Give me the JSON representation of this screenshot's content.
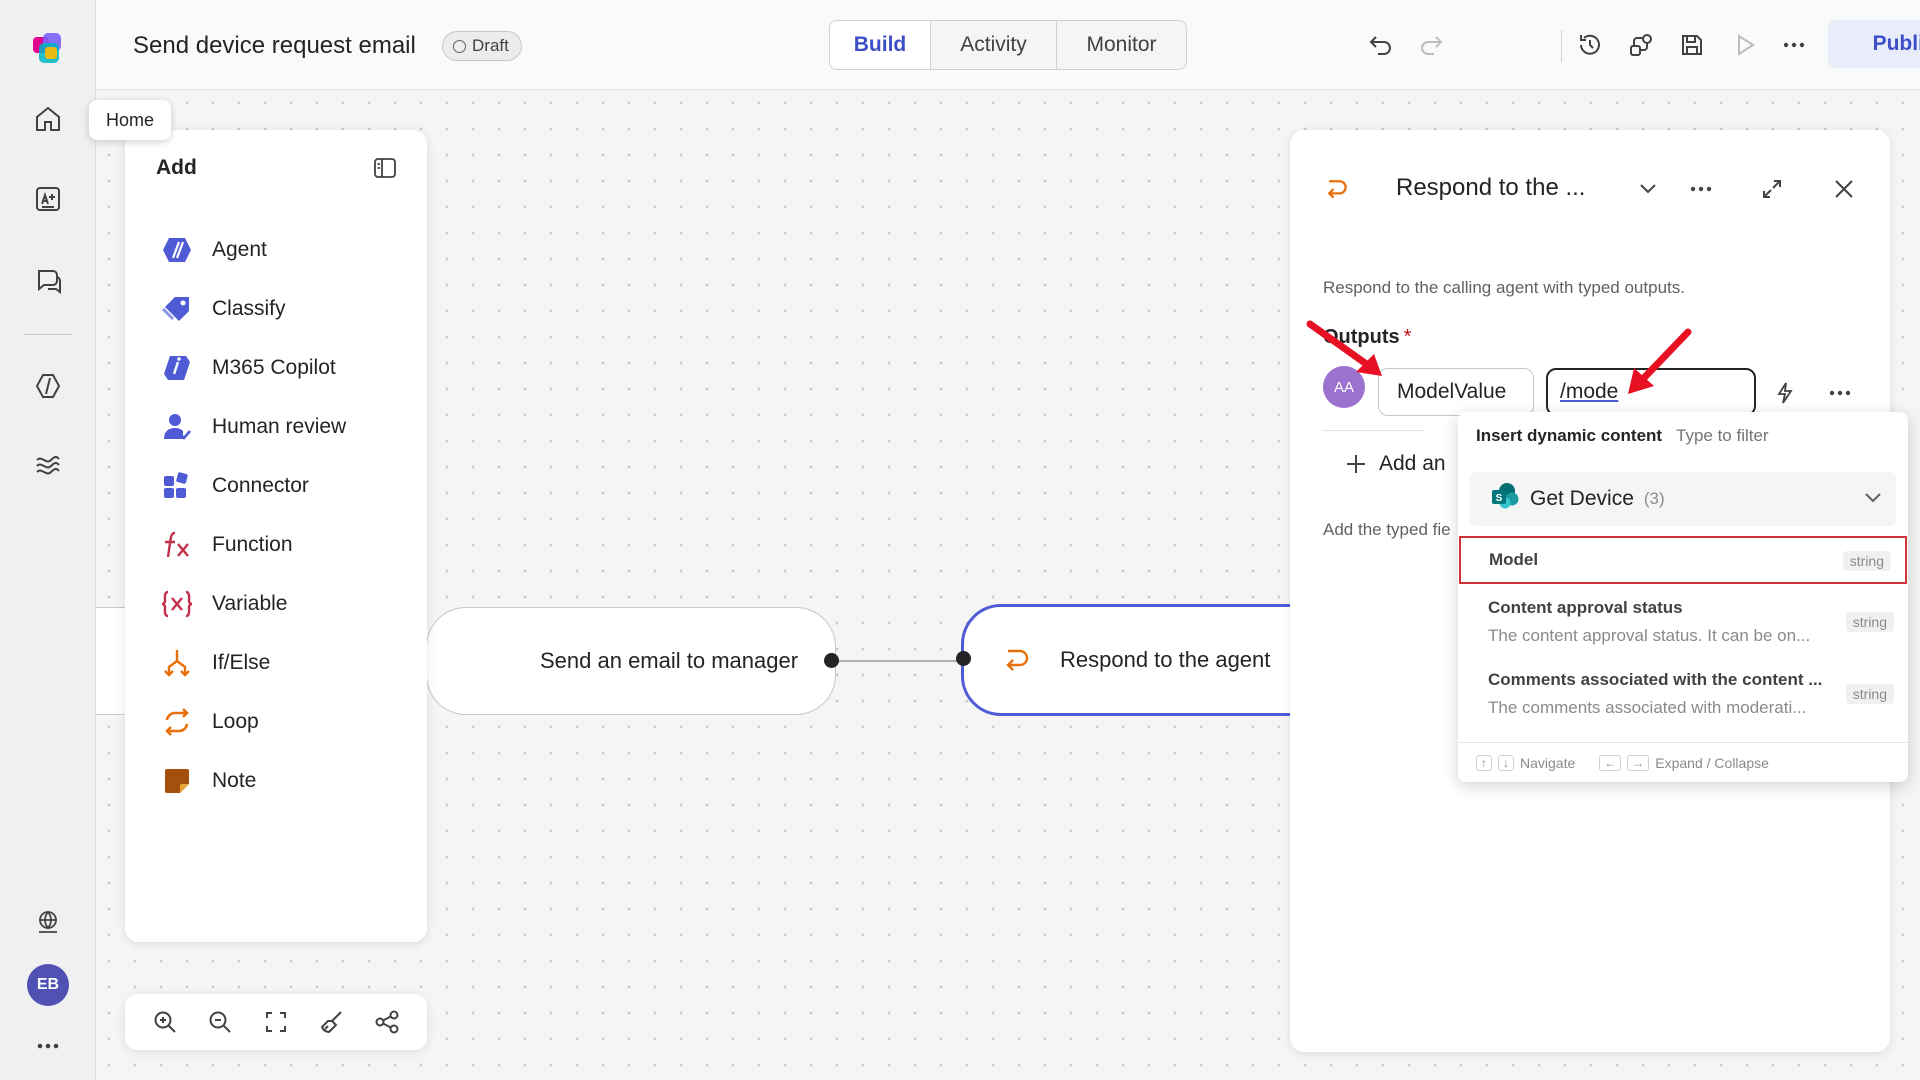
{
  "header": {
    "title": "Send device request email",
    "status_badge": "Draft",
    "tabs": [
      {
        "label": "Build",
        "active": true
      },
      {
        "label": "Activity",
        "active": false
      },
      {
        "label": "Monitor",
        "active": false
      }
    ],
    "toolbar_icons": [
      "undo-icon",
      "redo-icon",
      "history-icon",
      "connections-icon",
      "save-icon",
      "play-icon",
      "more-icon"
    ],
    "publish_label": "Publish"
  },
  "rail": {
    "items": [
      "app-logo-icon",
      "home-icon",
      "create-icon",
      "chat-icon",
      "agents-icon",
      "flows-icon"
    ],
    "bottom": [
      "globe-icon",
      "more-icon"
    ],
    "user_initials": "EB"
  },
  "tooltip": {
    "label": "Home"
  },
  "add_panel": {
    "title": "Add",
    "items": [
      {
        "label": "Agent",
        "icon": "agent-icon"
      },
      {
        "label": "Classify",
        "icon": "classify-icon"
      },
      {
        "label": "M365 Copilot",
        "icon": "copilot-icon"
      },
      {
        "label": "Human review",
        "icon": "human-review-icon"
      },
      {
        "label": "Connector",
        "icon": "connector-icon"
      },
      {
        "label": "Function",
        "icon": "function-icon"
      },
      {
        "label": "Variable",
        "icon": "variable-icon"
      },
      {
        "label": "If/Else",
        "icon": "if-else-icon"
      },
      {
        "label": "Loop",
        "icon": "loop-icon"
      },
      {
        "label": "Note",
        "icon": "note-icon"
      }
    ]
  },
  "canvas": {
    "nodes": [
      {
        "label": "Send an email to manager"
      },
      {
        "label": "Respond to the agent"
      }
    ]
  },
  "zoom_toolbar": [
    "zoom-in-icon",
    "zoom-out-icon",
    "fit-view-icon",
    "cleanup-icon",
    "layout-icon"
  ],
  "right_panel": {
    "title": "Respond to the ...",
    "description": "Respond to the calling agent with typed outputs.",
    "outputs_label": "Outputs",
    "required_mark": "*",
    "output_row": {
      "type_avatar": "AA",
      "name": "ModelValue",
      "value": "/mode"
    },
    "add_output_label": "Add an",
    "add_hint": "Add the typed fie"
  },
  "dynamic_content": {
    "header": "Insert dynamic content",
    "filter_placeholder": "Type to filter",
    "group": {
      "name": "Get Device",
      "count": "(3)"
    },
    "items": [
      {
        "title": "Model",
        "type": "string",
        "description": ""
      },
      {
        "title": "Content approval status",
        "type": "string",
        "description": "The content approval status. It can be on..."
      },
      {
        "title": "Comments associated with the content ...",
        "type": "string",
        "description": "The comments associated with moderati..."
      }
    ],
    "footer": {
      "navigate": "Navigate",
      "expand": "Expand / Collapse"
    }
  }
}
